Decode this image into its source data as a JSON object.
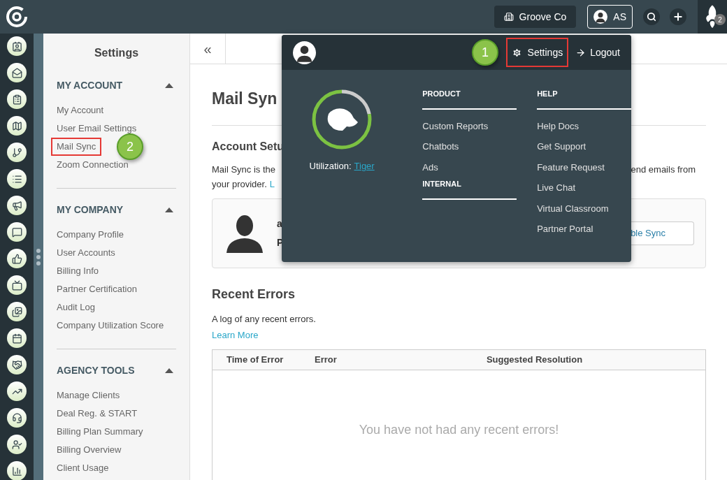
{
  "topbar": {
    "company": "Groove Co",
    "user": "AS",
    "notifications": "2"
  },
  "settings_sidebar": {
    "title": "Settings",
    "sections": [
      {
        "title": "MY ACCOUNT",
        "expanded": true,
        "items": [
          {
            "label": "My Account",
            "highlighted": false
          },
          {
            "label": "User Email Settings",
            "highlighted": false
          },
          {
            "label": "Mail Sync",
            "highlighted": true,
            "callout": "2"
          },
          {
            "label": "Zoom Connection",
            "highlighted": false
          }
        ]
      },
      {
        "title": "MY COMPANY",
        "expanded": true,
        "items": [
          {
            "label": "Company Profile",
            "highlighted": false
          },
          {
            "label": "User Accounts",
            "highlighted": false
          },
          {
            "label": "Billing Info",
            "highlighted": false
          },
          {
            "label": "Partner Certification",
            "highlighted": false
          },
          {
            "label": "Audit Log",
            "highlighted": false
          },
          {
            "label": "Company Utilization Score",
            "highlighted": false
          }
        ]
      },
      {
        "title": "AGENCY TOOLS",
        "expanded": true,
        "items": [
          {
            "label": "Manage Clients",
            "highlighted": false
          },
          {
            "label": "Deal Reg. & START",
            "highlighted": false
          },
          {
            "label": "Billing Plan Summary",
            "highlighted": false
          },
          {
            "label": "Billing Overview",
            "highlighted": false
          },
          {
            "label": "Client Usage",
            "highlighted": false
          }
        ]
      }
    ]
  },
  "main": {
    "collapse": "«",
    "title": "Mail Syn",
    "account_setup": {
      "heading": "Account Setu",
      "text_left_1": "Mail Sync is the",
      "text_right_1": "end emails from",
      "text_left_2": "your provider.",
      "link": "L",
      "card_line_1": "a",
      "card_line_2": "P",
      "button": "ble Sync"
    },
    "recent_errors": {
      "heading": "Recent Errors",
      "text": "A log of any recent errors.",
      "link": "Learn More",
      "table": {
        "columns": [
          "Time of Error",
          "Error",
          "Suggested Resolution"
        ],
        "empty": "You have not had any recent errors!"
      }
    }
  },
  "user_menu": {
    "settings": {
      "label": "Settings",
      "highlighted": true,
      "callout": "1"
    },
    "logout": "Logout",
    "utilization": {
      "label": "Utilization:",
      "link": "Tiger",
      "level": 0.78
    },
    "columns": [
      {
        "sections": [
          {
            "title": "PRODUCT",
            "items": [
              "Custom Reports",
              "Chatbots",
              "Ads"
            ]
          },
          {
            "title": "INTERNAL"
          }
        ]
      },
      {
        "sections": [
          {
            "title": "HELP",
            "items": [
              "Help Docs",
              "Get Support",
              "Feature Request",
              "Live Chat",
              "Virtual Classroom",
              "Partner Portal"
            ]
          }
        ]
      }
    ]
  }
}
